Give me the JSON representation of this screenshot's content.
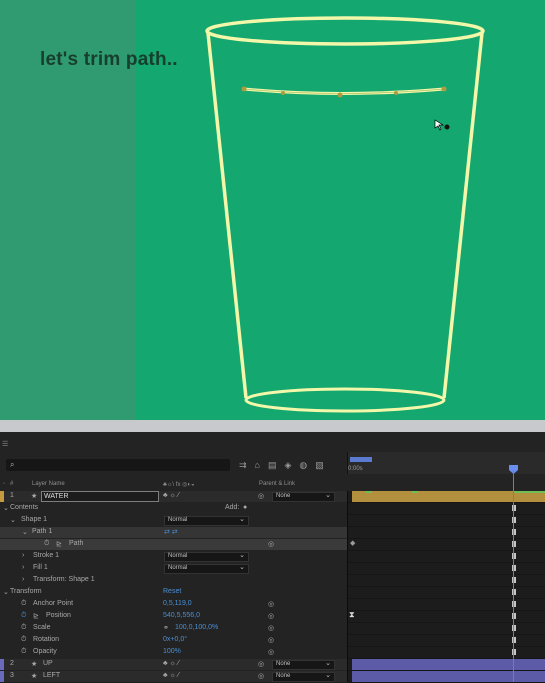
{
  "composition": {
    "caption": "let's trim path.."
  },
  "colors": {
    "background": "#14a870",
    "shade": "#309b70",
    "glass_stroke": "#f3f7a9",
    "caption": "#16402d",
    "label_tan": "#c69a3f",
    "label_purple": "#6b6bbd",
    "accent_blue": "#4a8fd4"
  },
  "timeline": {
    "time_label": "0:00s",
    "columns": {
      "index": "#",
      "layer_name": "Layer Name",
      "switches": "♣☼\\ fx ◎◐◒",
      "parent_link": "Parent & Link"
    },
    "layers": [
      {
        "index": "1",
        "name": "WATER",
        "parent": "None",
        "label_color": "#c69a3f"
      },
      {
        "index": "2",
        "name": "UP",
        "parent": "None",
        "label_color": "#6b6bbd"
      },
      {
        "index": "3",
        "name": "LEFT",
        "parent": "None",
        "label_color": "#6b6bbd"
      }
    ],
    "contents": {
      "label": "Contents",
      "add_label": "Add:",
      "shape": "Shape 1",
      "shape_mode": "Normal",
      "path_group": "Path 1",
      "path": "Path",
      "stroke": "Stroke 1",
      "stroke_mode": "Normal",
      "fill": "Fill 1",
      "fill_mode": "Normal",
      "transform_shape": "Transform: Shape 1"
    },
    "transform": {
      "label": "Transform",
      "reset": "Reset",
      "properties": [
        {
          "name": "Anchor Point",
          "value": "0,5,119,0"
        },
        {
          "name": "Position",
          "value": "540,5,556,0"
        },
        {
          "name": "Scale",
          "value": "100,0,100,0%"
        },
        {
          "name": "Rotation",
          "value": "0x+0,0°"
        },
        {
          "name": "Opacity",
          "value": "100%"
        }
      ]
    }
  }
}
